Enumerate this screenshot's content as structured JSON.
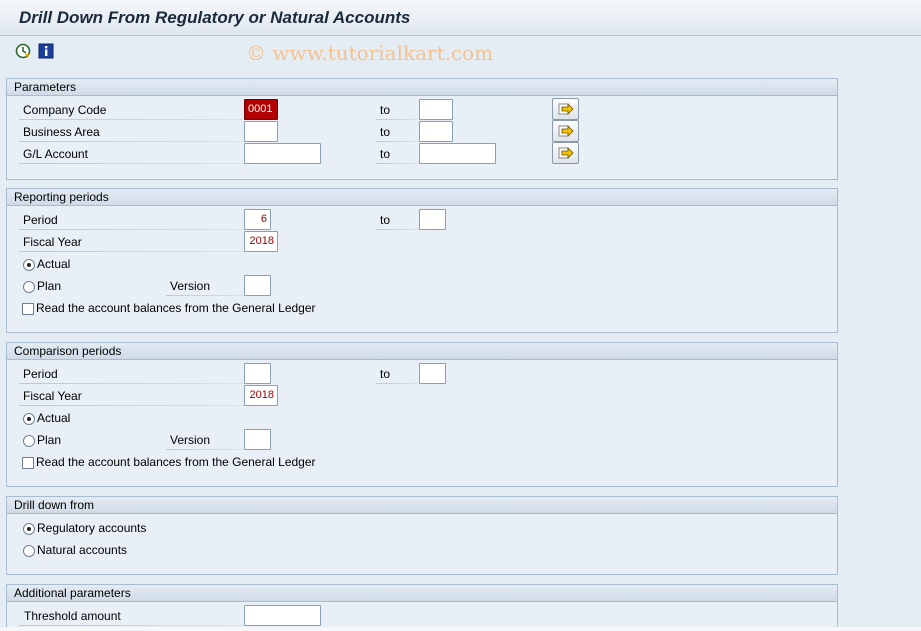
{
  "title": "Drill Down From Regulatory or Natural Accounts",
  "watermark": "© www.tutorialkart.com",
  "toolbar": {
    "items": [
      "execute-icon",
      "info-icon"
    ]
  },
  "colors": {
    "error_field": "#b30000",
    "value_text": "#990000",
    "background": "#e4ecf4"
  },
  "parameters": {
    "header": "Parameters",
    "company_code": {
      "label": "Company Code",
      "from": "0001",
      "to_label": "to",
      "to": ""
    },
    "business_area": {
      "label": "Business Area",
      "from": "",
      "to_label": "to",
      "to": ""
    },
    "gl_account": {
      "label": "G/L Account",
      "from": "",
      "to_label": "to",
      "to": ""
    }
  },
  "reporting": {
    "header": "Reporting periods",
    "period": {
      "label": "Period",
      "from": "6",
      "to_label": "to",
      "to": ""
    },
    "fiscal_year": {
      "label": "Fiscal Year",
      "value": "2018"
    },
    "actual": {
      "label": "Actual",
      "selected": true
    },
    "plan": {
      "label": "Plan",
      "selected": false
    },
    "version": {
      "label": "Version",
      "value": ""
    },
    "read_gl": {
      "label": "Read the account balances from the General Ledger",
      "checked": false
    }
  },
  "comparison": {
    "header": "Comparison periods",
    "period": {
      "label": "Period",
      "from": "",
      "to_label": "to",
      "to": ""
    },
    "fiscal_year": {
      "label": "Fiscal Year",
      "value": "2018"
    },
    "actual": {
      "label": "Actual",
      "selected": true
    },
    "plan": {
      "label": "Plan",
      "selected": false
    },
    "version": {
      "label": "Version",
      "value": ""
    },
    "read_gl": {
      "label": "Read the account balances from the General Ledger",
      "checked": false
    }
  },
  "drilldown": {
    "header": "Drill down from",
    "regulatory": {
      "label": "Regulatory accounts",
      "selected": true
    },
    "natural": {
      "label": "Natural accounts",
      "selected": false
    }
  },
  "additional": {
    "header": "Additional parameters",
    "threshold": {
      "label": "Threshold amount",
      "value": ""
    }
  }
}
